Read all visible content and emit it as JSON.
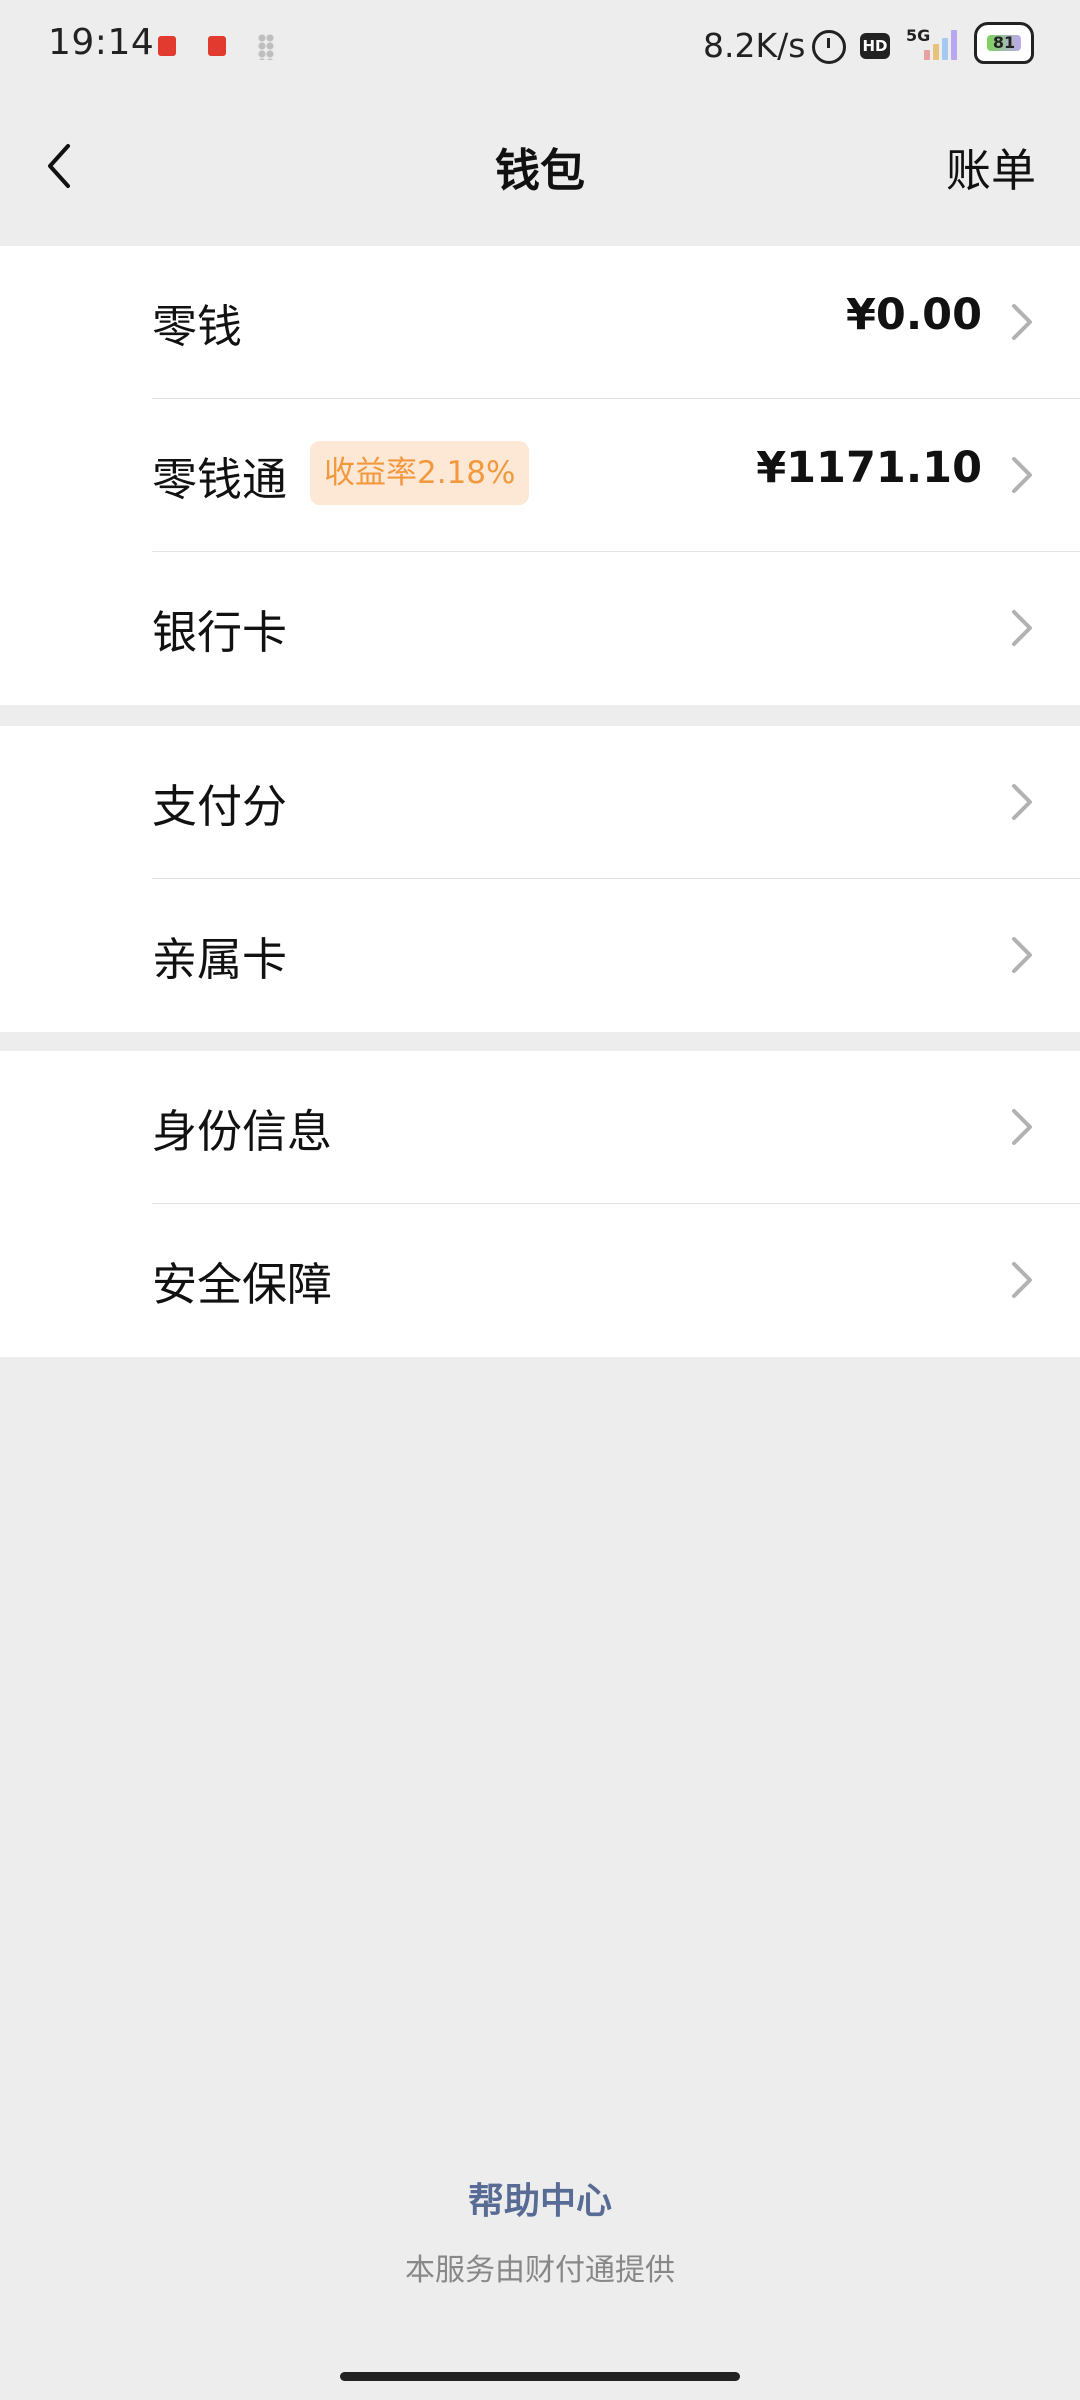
{
  "status_bar": {
    "time": "19:14",
    "net_speed": "8.2K/s",
    "network_type": "5G",
    "battery_level": "81",
    "icons": [
      "notification-icon",
      "notification-icon",
      "dots-icon",
      "alarm-icon",
      "hd-icon",
      "signal-icon",
      "battery-icon"
    ]
  },
  "nav": {
    "title": "钱包",
    "right_label": "账单",
    "back_icon": "chevron-left-icon"
  },
  "groups": [
    {
      "items": [
        {
          "label": "零钱",
          "value": "¥0.00"
        },
        {
          "label": "零钱通",
          "badge": "收益率2.18%",
          "value": "¥1171.10"
        },
        {
          "label": "银行卡"
        }
      ]
    },
    {
      "items": [
        {
          "label": "支付分"
        },
        {
          "label": "亲属卡"
        }
      ]
    },
    {
      "items": [
        {
          "label": "身份信息"
        },
        {
          "label": "安全保障"
        }
      ]
    }
  ],
  "footer": {
    "help_center": "帮助中心",
    "provider": "本服务由财付通提供"
  },
  "colors": {
    "background": "#ededed",
    "card": "#ffffff",
    "badge_bg": "#fde8d6",
    "badge_text": "#f2993f",
    "link": "#576b95"
  }
}
